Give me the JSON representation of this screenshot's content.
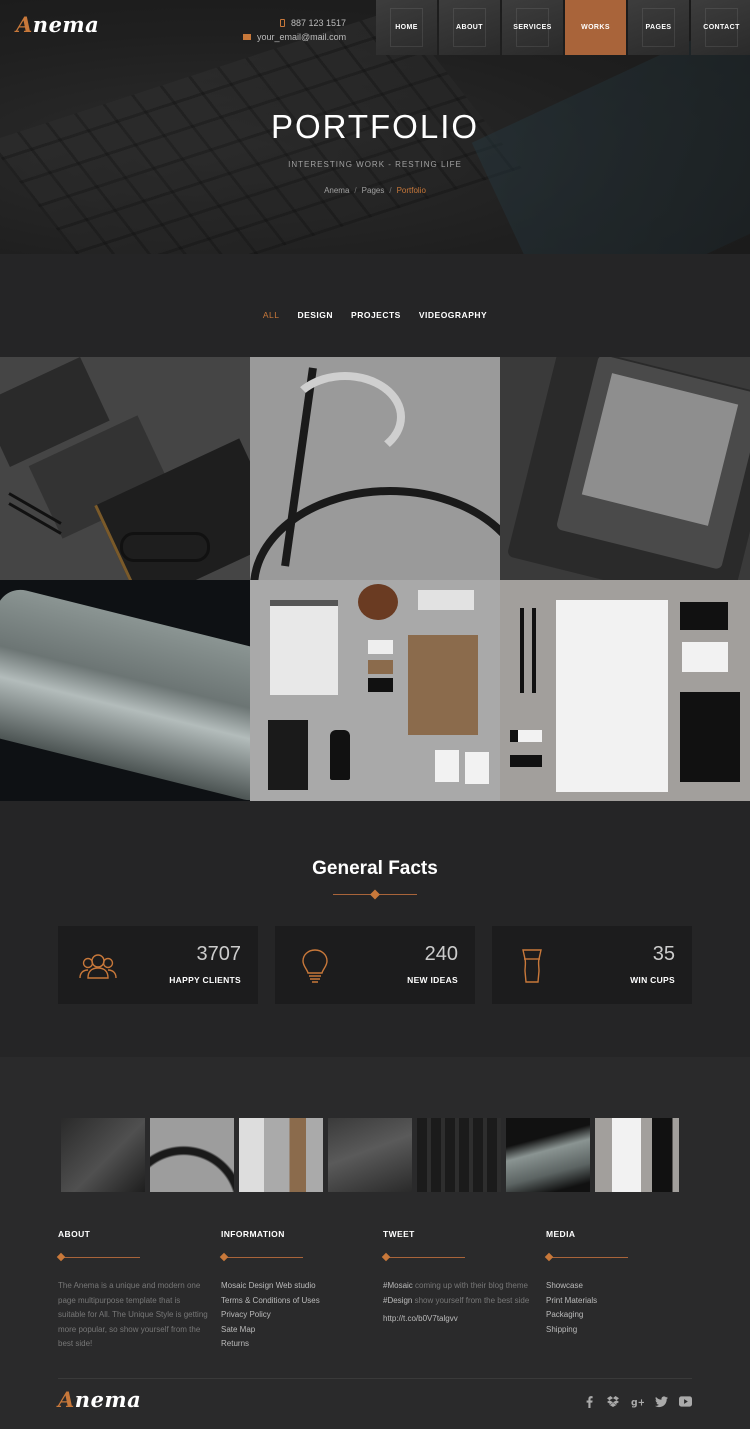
{
  "brand": {
    "initial": "A",
    "rest": "nema"
  },
  "contact": {
    "phone": "887 123 1517",
    "email": "your_email@mail.com"
  },
  "nav": [
    "HOME",
    "ABOUT",
    "SERVICES",
    "WORKS",
    "PAGES",
    "CONTACT"
  ],
  "nav_active": "WORKS",
  "hero": {
    "title": "PORTFOLIO",
    "subtitle": "INTERESTING WORK - RESTING LIFE",
    "breadcrumb": [
      "Anema",
      "Pages",
      "Portfolio"
    ]
  },
  "filters": [
    "ALL",
    "DESIGN",
    "PROJECTS",
    "VIDEOGRAPHY"
  ],
  "filter_active": "ALL",
  "facts": {
    "title": "General Facts",
    "items": [
      {
        "value": "3707",
        "label": "HAPPY CLIENTS",
        "icon": "users-icon"
      },
      {
        "value": "240",
        "label": "NEW IDEAS",
        "icon": "lightbulb-icon"
      },
      {
        "value": "35",
        "label": "WIN CUPS",
        "icon": "cup-icon"
      }
    ]
  },
  "footer": {
    "about": {
      "heading": "ABOUT",
      "text": "The Anema is a unique and modern one page multipurpose template that is suitable for All. The Unique Style is getting more popular, so show yourself from the best side!"
    },
    "information": {
      "heading": "INFORMATION",
      "links": [
        "Mosaic Design Web studio",
        "Terms & Conditions of Uses",
        "Privacy Policy",
        "Sate Map",
        "Returns"
      ]
    },
    "tweet": {
      "heading": "TWEET",
      "tag1": "#Mosaic",
      "text1": " coming up with their blog theme ",
      "tag2": "#Design",
      "text2": " show yourself from the best side",
      "url": "http://t.co/b0V7talgvv"
    },
    "media": {
      "heading": "MEDIA",
      "links": [
        "Showcase",
        "Print Materials",
        "Packaging",
        "Shipping"
      ]
    },
    "social_icons": [
      "facebook-icon",
      "dropbox-icon",
      "google-plus-icon",
      "twitter-icon",
      "youtube-icon"
    ]
  },
  "colors": {
    "accent": "#c8783a",
    "dark": "#252526",
    "panel": "#1c1c1d"
  }
}
